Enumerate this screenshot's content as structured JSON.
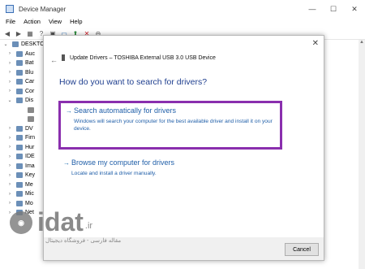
{
  "window": {
    "title": "Device Manager",
    "controls": [
      "—",
      "☐",
      "✕"
    ]
  },
  "menu": [
    "File",
    "Action",
    "View",
    "Help"
  ],
  "toolbar_icons": [
    "back-icon",
    "forward-icon",
    "properties-icon",
    "help-icon",
    "scan-icon",
    "monitor-icon",
    "update-driver-icon",
    "uninstall-icon",
    "disable-icon"
  ],
  "tree": {
    "root": "DESKTO",
    "items": [
      {
        "label": "Auc",
        "expander": "›"
      },
      {
        "label": "Bat",
        "expander": "›"
      },
      {
        "label": "Blu",
        "expander": "›"
      },
      {
        "label": "Car",
        "expander": "›"
      },
      {
        "label": "Cor",
        "expander": "›"
      },
      {
        "label": "Dis",
        "expander": "⌄"
      },
      {
        "label": "",
        "expander": "",
        "child": true
      },
      {
        "label": "",
        "expander": "",
        "child": true
      },
      {
        "label": "DV",
        "expander": "›"
      },
      {
        "label": "Firn",
        "expander": "›"
      },
      {
        "label": "Hur",
        "expander": "›"
      },
      {
        "label": "IDE",
        "expander": "›"
      },
      {
        "label": "Ima",
        "expander": "›"
      },
      {
        "label": "Key",
        "expander": "›"
      },
      {
        "label": "Me",
        "expander": "›"
      },
      {
        "label": "Mic",
        "expander": "›"
      },
      {
        "label": "Mo",
        "expander": "›"
      },
      {
        "label": "Net",
        "expander": "›"
      }
    ]
  },
  "dialog": {
    "close": "✕",
    "back": "←",
    "header": "Update Drivers – TOSHIBA External USB 3.0 USB Device",
    "question": "How do you want to search for drivers?",
    "option1": {
      "arrow": "→",
      "label": "Search automatically for drivers",
      "description": "Windows will search your computer for the best available driver and install it on your device."
    },
    "option2": {
      "arrow": "→",
      "label": "Browse my computer for drivers",
      "description": "Locate and install a driver manually."
    },
    "cancel": "Cancel"
  },
  "watermark": {
    "brand": "idat",
    "tld": ".ir",
    "tagline": "مقاله فارسی - فروشگاه دیجیتال"
  },
  "colors": {
    "highlight": "#8a2fae",
    "link": "#1f5ea8"
  }
}
